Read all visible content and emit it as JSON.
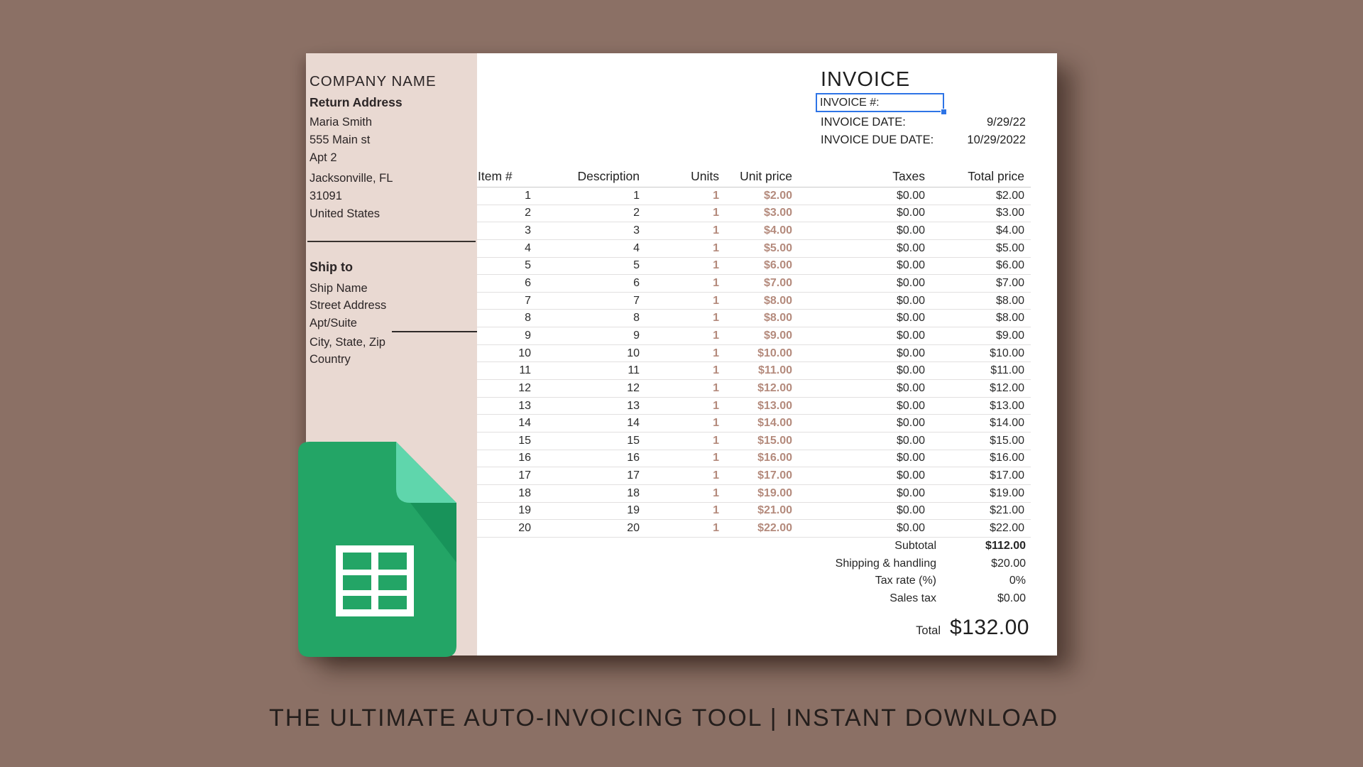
{
  "page": {
    "caption": "THE ULTIMATE AUTO-INVOICING TOOL | INSTANT DOWNLOAD"
  },
  "colors": {
    "background": "#8b7065",
    "sidebar": "#e9d9d2",
    "accent_price": "#b48a7c",
    "selection_blue": "#2e74e6",
    "logo_green": "#23a566",
    "logo_fold_light": "#5fd6ac",
    "logo_fold_shadow": "#18935a"
  },
  "sidebar": {
    "company_name": "COMPANY NAME",
    "return_address_label": "Return Address",
    "return_address_lines": [
      "Maria Smith",
      "555 Main st",
      "Apt 2",
      "Jacksonville, FL",
      "31091",
      "United States"
    ],
    "ship_to_label": "Ship to",
    "ship_to_lines": [
      "Ship Name",
      "Street Address",
      "Apt/Suite",
      "City, State, Zip",
      "Country"
    ]
  },
  "invoice_header": {
    "title": "INVOICE",
    "number_label": "INVOICE #:",
    "number_value": "",
    "date_label": "INVOICE DATE:",
    "date_value": "9/29/22",
    "due_date_label": "INVOICE DUE DATE:",
    "due_date_value": "10/29/2022"
  },
  "table": {
    "columns": [
      "Item #",
      "Description",
      "Units",
      "Unit price",
      "Taxes",
      "Total price"
    ],
    "rows": [
      [
        "1",
        "1",
        "1",
        "$2.00",
        "$0.00",
        "$2.00"
      ],
      [
        "2",
        "2",
        "1",
        "$3.00",
        "$0.00",
        "$3.00"
      ],
      [
        "3",
        "3",
        "1",
        "$4.00",
        "$0.00",
        "$4.00"
      ],
      [
        "4",
        "4",
        "1",
        "$5.00",
        "$0.00",
        "$5.00"
      ],
      [
        "5",
        "5",
        "1",
        "$6.00",
        "$0.00",
        "$6.00"
      ],
      [
        "6",
        "6",
        "1",
        "$7.00",
        "$0.00",
        "$7.00"
      ],
      [
        "7",
        "7",
        "1",
        "$8.00",
        "$0.00",
        "$8.00"
      ],
      [
        "8",
        "8",
        "1",
        "$8.00",
        "$0.00",
        "$8.00"
      ],
      [
        "9",
        "9",
        "1",
        "$9.00",
        "$0.00",
        "$9.00"
      ],
      [
        "10",
        "10",
        "1",
        "$10.00",
        "$0.00",
        "$10.00"
      ],
      [
        "11",
        "11",
        "1",
        "$11.00",
        "$0.00",
        "$11.00"
      ],
      [
        "12",
        "12",
        "1",
        "$12.00",
        "$0.00",
        "$12.00"
      ],
      [
        "13",
        "13",
        "1",
        "$13.00",
        "$0.00",
        "$13.00"
      ],
      [
        "14",
        "14",
        "1",
        "$14.00",
        "$0.00",
        "$14.00"
      ],
      [
        "15",
        "15",
        "1",
        "$15.00",
        "$0.00",
        "$15.00"
      ],
      [
        "16",
        "16",
        "1",
        "$16.00",
        "$0.00",
        "$16.00"
      ],
      [
        "17",
        "17",
        "1",
        "$17.00",
        "$0.00",
        "$17.00"
      ],
      [
        "18",
        "18",
        "1",
        "$19.00",
        "$0.00",
        "$19.00"
      ],
      [
        "19",
        "19",
        "1",
        "$21.00",
        "$0.00",
        "$21.00"
      ],
      [
        "20",
        "20",
        "1",
        "$22.00",
        "$0.00",
        "$22.00"
      ]
    ]
  },
  "summary": {
    "rows": [
      {
        "label": "Subtotal",
        "value": "$112.00",
        "bold": true
      },
      {
        "label": "Shipping & handling",
        "value": "$20.00",
        "bold": false
      },
      {
        "label": "Tax rate (%)",
        "value": "0%",
        "bold": false
      },
      {
        "label": "Sales tax",
        "value": "$0.00",
        "bold": false
      }
    ],
    "total_label": "Total",
    "total_value": "$132.00"
  },
  "logo": {
    "name": "google-sheets-logo"
  }
}
